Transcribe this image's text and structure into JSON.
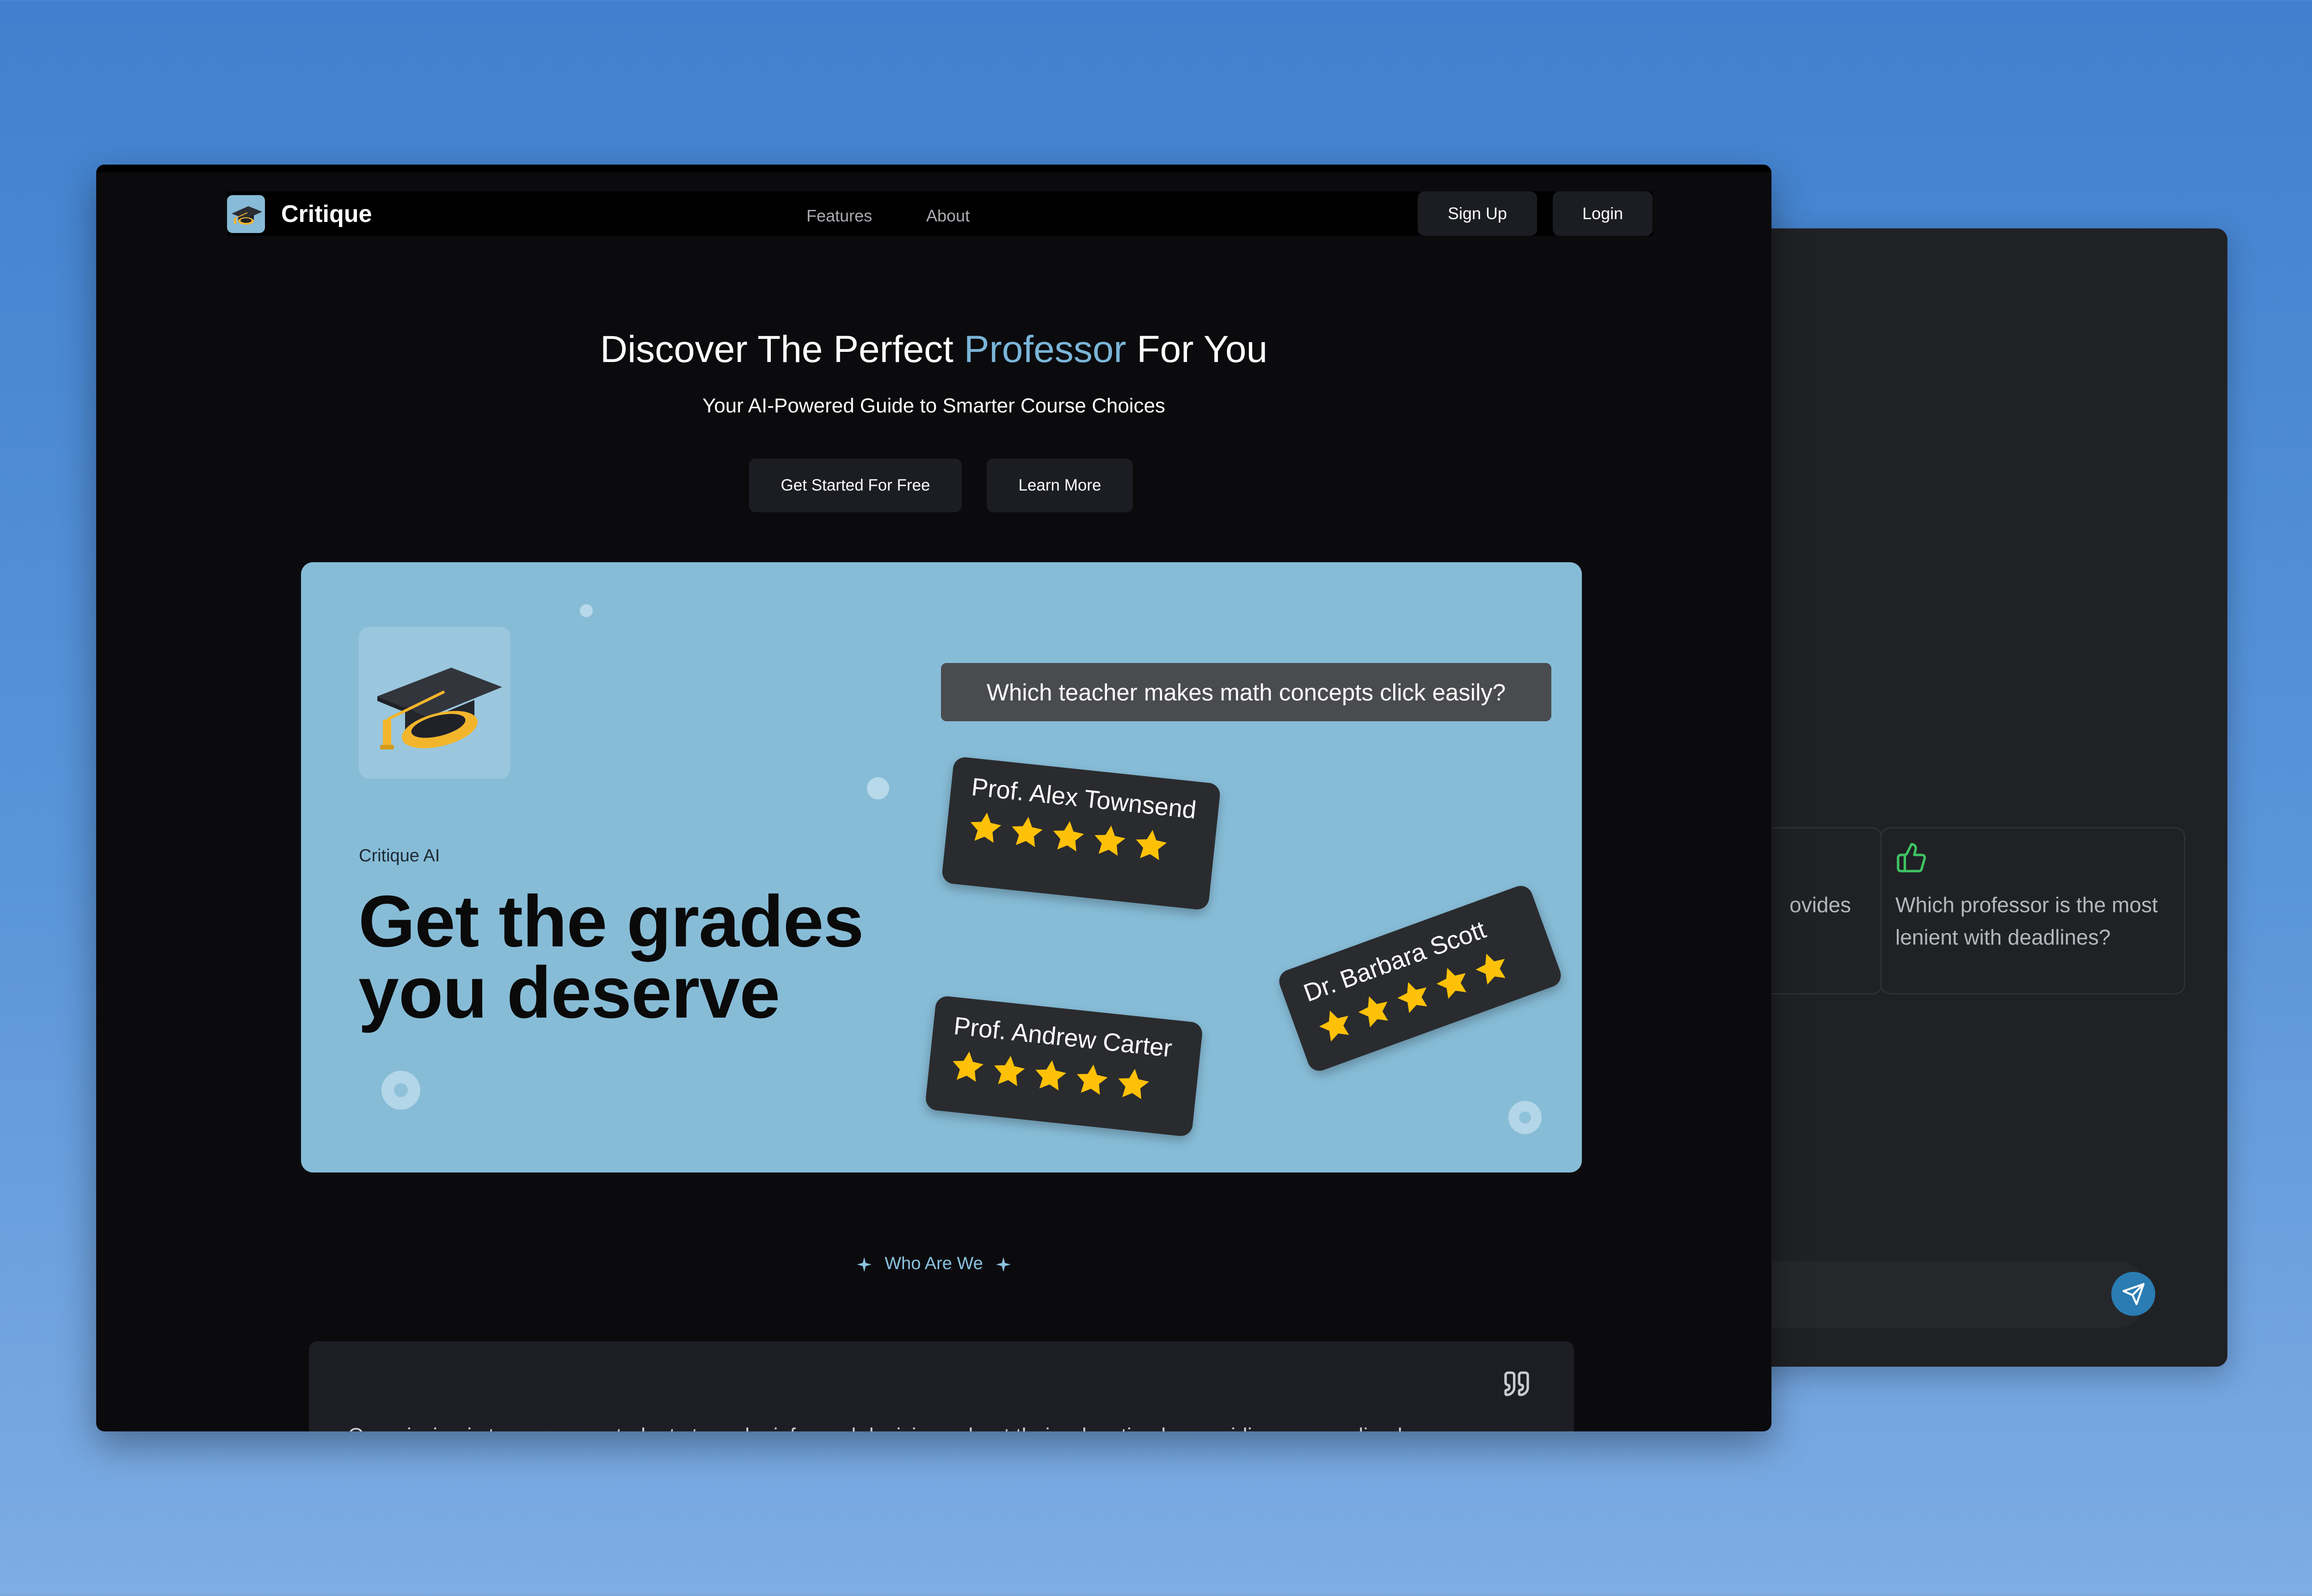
{
  "chat_window": {
    "suggestions": [
      {
        "text": "ovides"
      },
      {
        "text": "Which professor is the most lenient with deadlines?"
      }
    ],
    "input_placeholder": ""
  },
  "nav": {
    "brand": "Critique",
    "links": [
      "Features",
      "About"
    ],
    "signup_label": "Sign Up",
    "login_label": "Login"
  },
  "hero": {
    "title_pre": "Discover The Perfect ",
    "title_highlight": "Professor",
    "title_post": " For You",
    "subtitle": "Your AI-Powered Guide to Smarter Course Choices",
    "primary_cta": "Get Started For Free",
    "secondary_cta": "Learn More"
  },
  "banner": {
    "eyebrow": "Critique AI",
    "headline_line1": "Get the grades",
    "headline_line2": "you deserve",
    "question": "Which teacher makes math concepts click easily?",
    "professors": [
      {
        "name": "Prof. Alex Townsend",
        "stars": 5
      },
      {
        "name": "Dr. Barbara Scott",
        "stars": 5
      },
      {
        "name": "Prof. Andrew Carter",
        "stars": 5
      }
    ]
  },
  "section": {
    "who_label": "Who Are We",
    "testimonial_partial": "Our mission is to empower students to make informed decisions about their education by providing personalized"
  },
  "colors": {
    "accent": "#7ab5d8",
    "banner_bg": "#87bcd7",
    "star": "#ffc107",
    "page_bg": "#0b0b0e"
  }
}
